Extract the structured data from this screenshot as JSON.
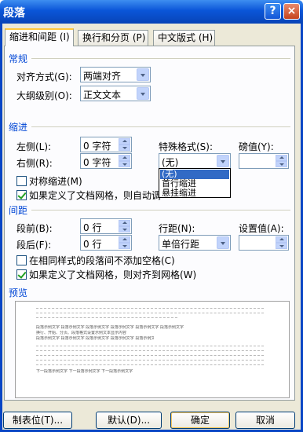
{
  "window": {
    "title": "段落",
    "help_symbol": "?",
    "close_symbol": "×"
  },
  "tabs": [
    {
      "label": "缩进和间距 (I)",
      "active": true
    },
    {
      "label": "换行和分页 (P)",
      "active": false
    },
    {
      "label": "中文版式 (H)",
      "active": false
    }
  ],
  "general": {
    "heading": "常规",
    "alignment_label": "对齐方式(G):",
    "alignment_value": "两端对齐",
    "outline_label": "大纲级别(O):",
    "outline_value": "正文文本"
  },
  "indent": {
    "heading": "缩进",
    "left_label": "左侧(L):",
    "left_value": "0 字符",
    "right_label": "右侧(R):",
    "right_value": "0 字符",
    "special_label": "特殊格式(S):",
    "special_value": "(无)",
    "by_label": "磅值(Y):",
    "by_value": "",
    "mirror_label": "对称缩进(M)",
    "mirror_checked": false,
    "grid_label": "如果定义了文档网格，则自动调",
    "grid_checked": true,
    "dropdown_options": [
      "(无)",
      "首行缩进",
      "悬挂缩进"
    ],
    "dropdown_selected": "(无)"
  },
  "spacing": {
    "heading": "间距",
    "before_label": "段前(B):",
    "before_value": "0 行",
    "after_label": "段后(F):",
    "after_value": "0 行",
    "line_label": "行距(N):",
    "line_value": "单倍行距",
    "at_label": "设置值(A):",
    "at_value": "",
    "no_space_label": "在相同样式的段落间不添加空格(C)",
    "no_space_checked": false,
    "snap_label": "如果定义了文档网格，则对齐到网格(W)",
    "snap_checked": true
  },
  "preview": {
    "heading": "预览",
    "line1": "段落示例文字 段落示例文字 段落示例文字 段落示例文字 段落示例文字 段落示例文字",
    "line2": "换行、开始、分页、段落格式设置示例文本显示内容",
    "line3": "下一段落示例文字 下一段落示例文字 下一段落示例文字"
  },
  "buttons": {
    "tabs": "制表位(T)...",
    "default": "默认(D)...",
    "ok": "确定",
    "cancel": "取消"
  }
}
